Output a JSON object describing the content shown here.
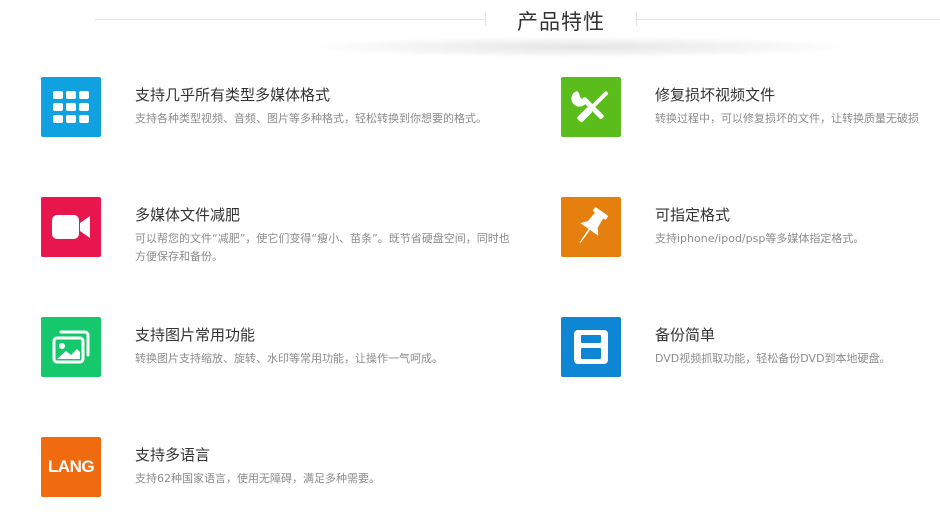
{
  "header": {
    "title": "产品特性"
  },
  "colors": {
    "blue": "#10a1e0",
    "green": "#5bbd1c",
    "pink": "#e8164c",
    "orange": "#e57f0d",
    "mint": "#15c86c",
    "navy": "#0f86d4",
    "lang_orange": "#f06b10"
  },
  "features": [
    {
      "icon": "grid-icon",
      "title": "支持几乎所有类型多媒体格式",
      "desc": "支持各种类型视频、音频、图片等多种格式，轻松转换到你想要的格式。"
    },
    {
      "icon": "repair-tools-icon",
      "title": "修复损坏视频文件",
      "desc": "转换过程中，可以修复损坏的文件，让转换质量无破损"
    },
    {
      "icon": "video-camera-icon",
      "title": "多媒体文件减肥",
      "desc": "可以帮您的文件“减肥”，使它们变得“瘦小、苗条”。既节省硬盘空间，同时也方便保存和备份。"
    },
    {
      "icon": "pushpin-icon",
      "title": "可指定格式",
      "desc": "支持iphone/ipod/psp等多媒体指定格式。"
    },
    {
      "icon": "picture-icon",
      "title": "支持图片常用功能",
      "desc": "转换图片支持缩放、旋转、水印等常用功能，让操作一气呵成。"
    },
    {
      "icon": "floppy-disk-icon",
      "title": "备份简单",
      "desc": "DVD视频抓取功能，轻松备份DVD到本地硬盘。"
    },
    {
      "icon": "lang-icon",
      "icon_text": "LANG",
      "title": "支持多语言",
      "desc": "支持62种国家语言，使用无障碍，满足多种需要。"
    }
  ]
}
